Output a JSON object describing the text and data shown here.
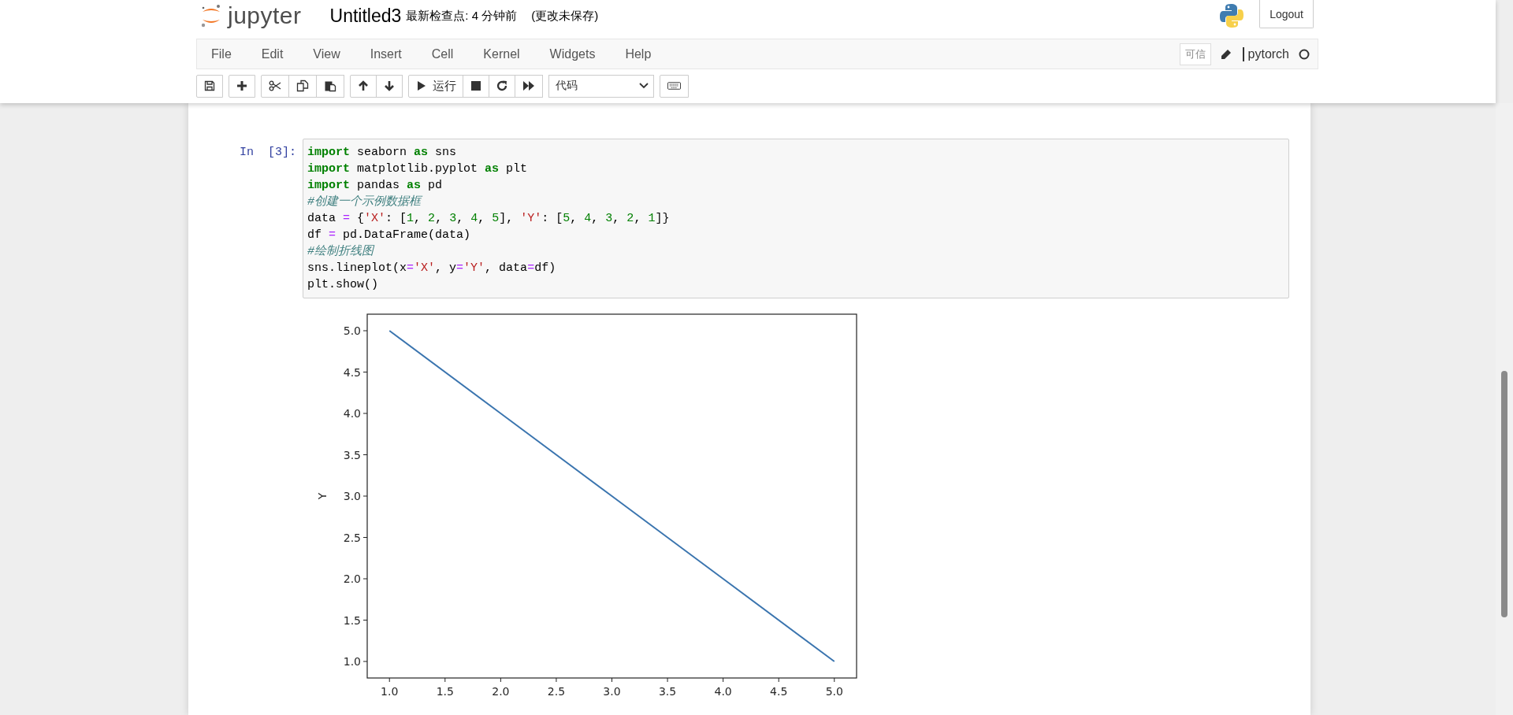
{
  "header": {
    "logo_text": "jupyter",
    "notebook_name": "Untitled3",
    "checkpoint": "最新检查点: 4 分钟前",
    "save_status": "(更改未保存)",
    "logout": "Logout"
  },
  "menu": [
    "File",
    "Edit",
    "View",
    "Insert",
    "Cell",
    "Kernel",
    "Widgets",
    "Help"
  ],
  "menu_right": {
    "trusted": "可信",
    "kernel_name": "pytorch",
    "kernel_busy": false
  },
  "toolbar": {
    "run_label": "运行",
    "cell_type": "代码"
  },
  "cell": {
    "prompt": "In  [3]:",
    "lines": [
      [
        {
          "text": "import",
          "kind": "keyword"
        },
        {
          "text": " seaborn ",
          "kind": "plain"
        },
        {
          "text": "as",
          "kind": "keyword"
        },
        {
          "text": " sns",
          "kind": "plain"
        }
      ],
      [
        {
          "text": "import",
          "kind": "keyword"
        },
        {
          "text": " matplotlib.pyplot ",
          "kind": "plain"
        },
        {
          "text": "as",
          "kind": "keyword"
        },
        {
          "text": " plt",
          "kind": "plain"
        }
      ],
      [
        {
          "text": "import",
          "kind": "keyword"
        },
        {
          "text": " pandas ",
          "kind": "plain"
        },
        {
          "text": "as",
          "kind": "keyword"
        },
        {
          "text": " pd",
          "kind": "plain"
        }
      ],
      [
        {
          "text": "#创建一个示例数据框",
          "kind": "comment"
        }
      ],
      [
        {
          "text": "data ",
          "kind": "plain"
        },
        {
          "text": "=",
          "kind": "operator"
        },
        {
          "text": " {",
          "kind": "plain"
        },
        {
          "text": "'X'",
          "kind": "string"
        },
        {
          "text": ": [",
          "kind": "plain"
        },
        {
          "text": "1",
          "kind": "number"
        },
        {
          "text": ", ",
          "kind": "plain"
        },
        {
          "text": "2",
          "kind": "number"
        },
        {
          "text": ", ",
          "kind": "plain"
        },
        {
          "text": "3",
          "kind": "number"
        },
        {
          "text": ", ",
          "kind": "plain"
        },
        {
          "text": "4",
          "kind": "number"
        },
        {
          "text": ", ",
          "kind": "plain"
        },
        {
          "text": "5",
          "kind": "number"
        },
        {
          "text": "], ",
          "kind": "plain"
        },
        {
          "text": "'Y'",
          "kind": "string"
        },
        {
          "text": ": [",
          "kind": "plain"
        },
        {
          "text": "5",
          "kind": "number"
        },
        {
          "text": ", ",
          "kind": "plain"
        },
        {
          "text": "4",
          "kind": "number"
        },
        {
          "text": ", ",
          "kind": "plain"
        },
        {
          "text": "3",
          "kind": "number"
        },
        {
          "text": ", ",
          "kind": "plain"
        },
        {
          "text": "2",
          "kind": "number"
        },
        {
          "text": ", ",
          "kind": "plain"
        },
        {
          "text": "1",
          "kind": "number"
        },
        {
          "text": "]}",
          "kind": "plain"
        }
      ],
      [
        {
          "text": "df ",
          "kind": "plain"
        },
        {
          "text": "=",
          "kind": "operator"
        },
        {
          "text": " pd.DataFrame(data)",
          "kind": "plain"
        }
      ],
      [
        {
          "text": "#绘制折线图",
          "kind": "comment"
        }
      ],
      [
        {
          "text": "sns.lineplot(x",
          "kind": "plain"
        },
        {
          "text": "=",
          "kind": "operator"
        },
        {
          "text": "'X'",
          "kind": "string"
        },
        {
          "text": ", y",
          "kind": "plain"
        },
        {
          "text": "=",
          "kind": "operator"
        },
        {
          "text": "'Y'",
          "kind": "string"
        },
        {
          "text": ", data",
          "kind": "plain"
        },
        {
          "text": "=",
          "kind": "operator"
        },
        {
          "text": "df)",
          "kind": "plain"
        }
      ],
      [
        {
          "text": "plt.show()",
          "kind": "plain"
        }
      ]
    ],
    "chart_data": {
      "type": "line",
      "ylabel": "Y",
      "x": [
        1,
        2,
        3,
        4,
        5
      ],
      "series": [
        {
          "color": "#3b75af",
          "values": [
            5,
            4,
            3,
            2,
            1
          ]
        }
      ],
      "xlim": [
        0.8,
        5.2
      ],
      "ylim": [
        0.8,
        5.2
      ],
      "xticks": [
        {
          "value": 1,
          "label": "1.0"
        },
        {
          "value": 1.5,
          "label": "1.5"
        },
        {
          "value": 2,
          "label": "2.0"
        },
        {
          "value": 2.5,
          "label": "2.5"
        },
        {
          "value": 3,
          "label": "3.0"
        },
        {
          "value": 3.5,
          "label": "3.5"
        },
        {
          "value": 4,
          "label": "4.0"
        },
        {
          "value": 4.5,
          "label": "4.5"
        },
        {
          "value": 5,
          "label": "5.0"
        }
      ],
      "yticks": [
        {
          "value": 1,
          "label": "1.0"
        },
        {
          "value": 1.5,
          "label": "1.5"
        },
        {
          "value": 2,
          "label": "2.0"
        },
        {
          "value": 2.5,
          "label": "2.5"
        },
        {
          "value": 3,
          "label": "3.0"
        },
        {
          "value": 3.5,
          "label": "3.5"
        },
        {
          "value": 4,
          "label": "4.0"
        },
        {
          "value": 4.5,
          "label": "4.5"
        },
        {
          "value": 5,
          "label": "5.0"
        }
      ]
    }
  }
}
